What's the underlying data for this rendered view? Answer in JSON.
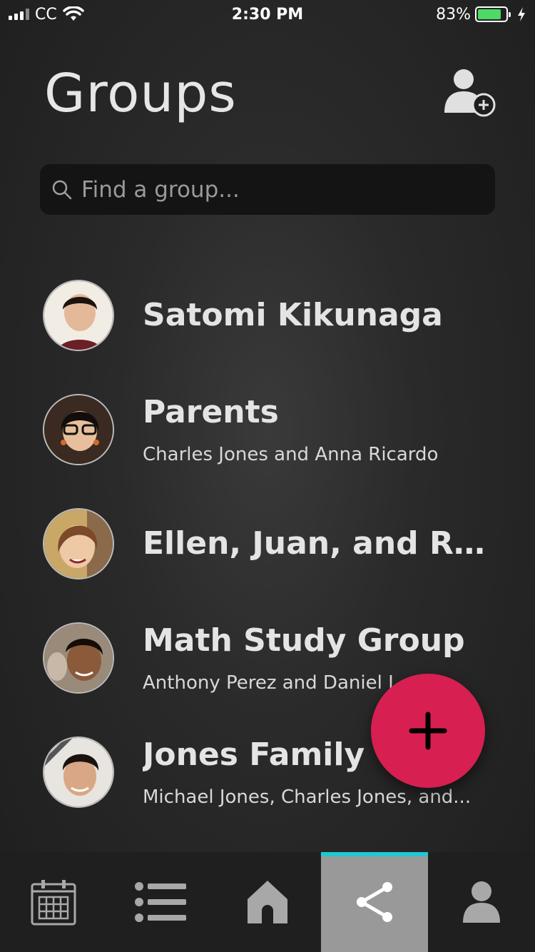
{
  "status_bar": {
    "carrier": "CC",
    "time": "2:30 PM",
    "battery_percent": "83%",
    "battery_level": 0.83
  },
  "header": {
    "title": "Groups",
    "add_user_icon": "add-user-icon"
  },
  "search": {
    "placeholder": "Find a group...",
    "value": ""
  },
  "groups": [
    {
      "name": "Satomi Kikunaga",
      "members": "",
      "avatar_color": "#c9a48a"
    },
    {
      "name": "Parents",
      "members": "Charles Jones and Anna Ricardo",
      "avatar_color": "#b38a6a"
    },
    {
      "name": "Ellen, Juan, and Ra...",
      "members": "",
      "avatar_color": "#d6b08f"
    },
    {
      "name": "Math Study Group",
      "members": "Anthony Perez and Daniel L...",
      "avatar_color": "#8a5a3f"
    },
    {
      "name": "Jones Family",
      "members": "Michael Jones, Charles Jones, and...",
      "avatar_color": "#c49577"
    }
  ],
  "fab": {
    "icon": "plus-icon",
    "color": "#d81f52"
  },
  "tab_bar": {
    "tabs": [
      {
        "icon": "calendar-icon",
        "active": false
      },
      {
        "icon": "list-icon",
        "active": false
      },
      {
        "icon": "home-icon",
        "active": false
      },
      {
        "icon": "share-icon",
        "active": true
      },
      {
        "icon": "profile-icon",
        "active": false
      }
    ],
    "active_color": "#999999",
    "indicator_color": "#20c9d2"
  }
}
